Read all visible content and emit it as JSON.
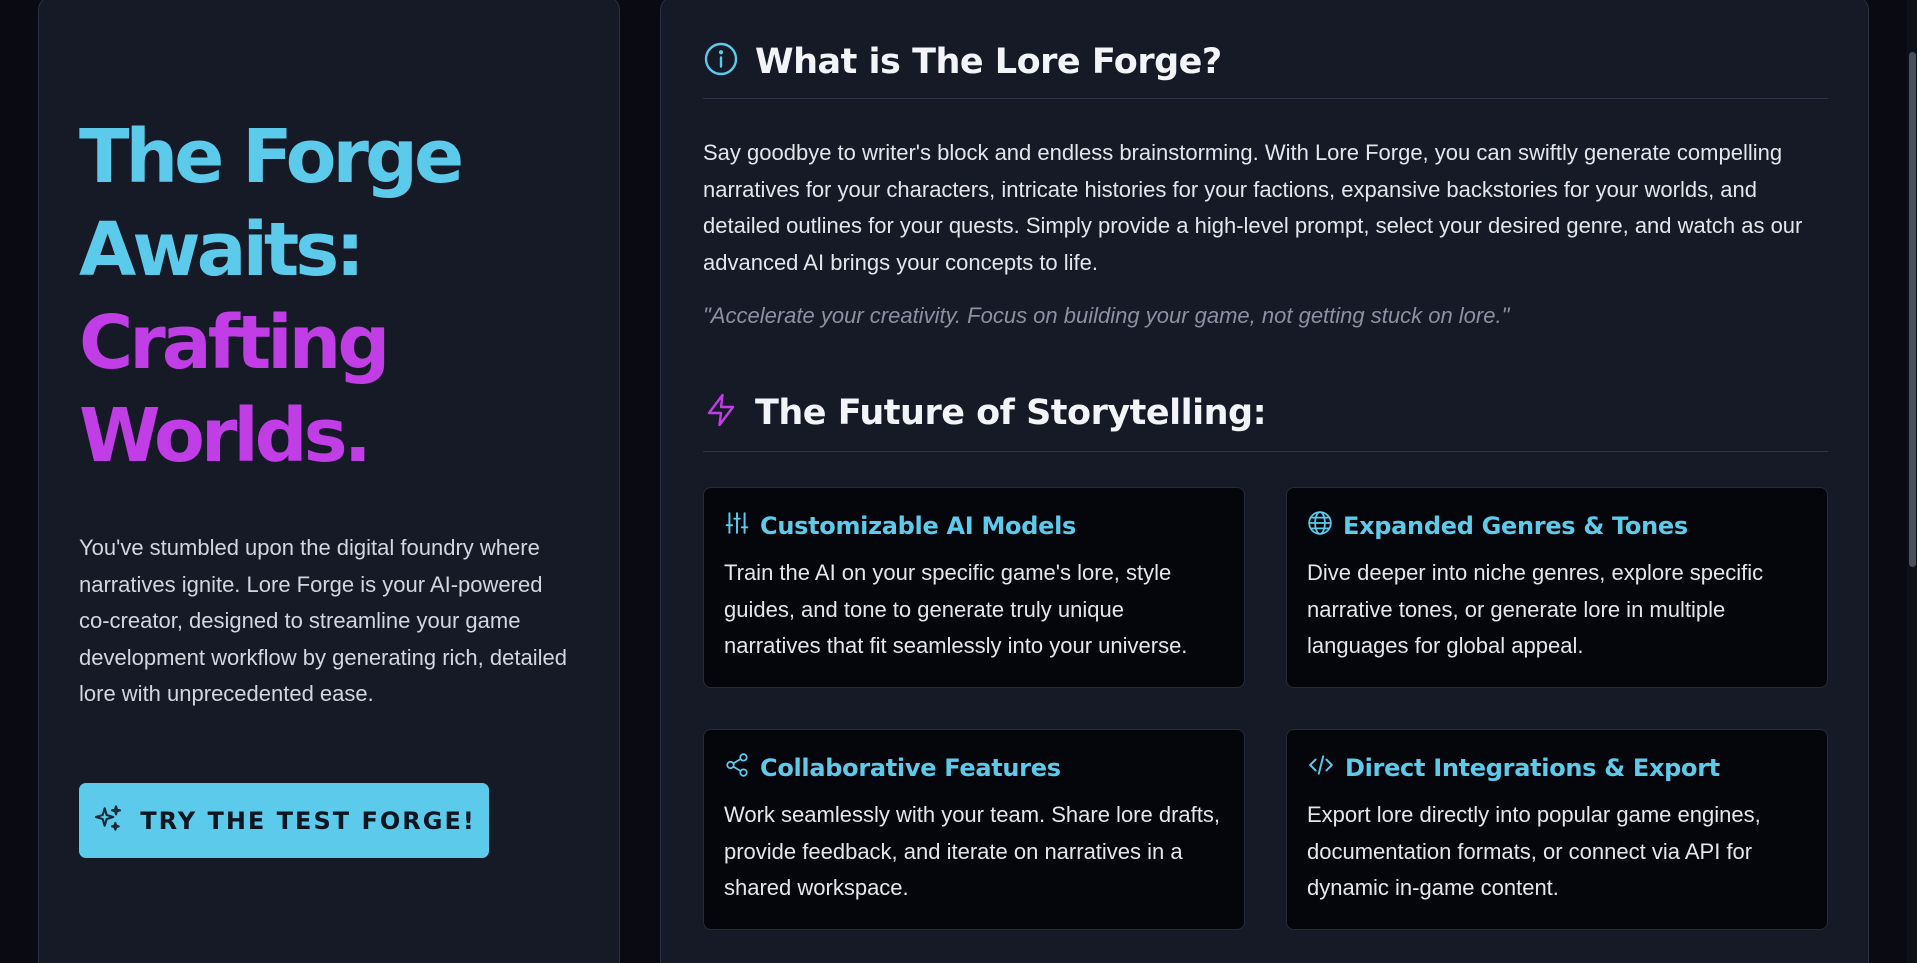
{
  "hero": {
    "title_line1": "The Forge",
    "title_line2": "Awaits:",
    "title_line3": "Crafting",
    "title_line4": "Worlds.",
    "description": "You've stumbled upon the digital foundry where narratives ignite. Lore Forge is your AI-powered co-creator, designed to streamline your game development workflow by generating rich, detailed lore with unprecedented ease.",
    "cta_label": "TRY THE TEST FORGE!",
    "cta_icon": "sparkles-icon"
  },
  "about": {
    "heading": "What is The Lore Forge?",
    "icon": "info-icon",
    "text": "Say goodbye to writer's block and endless brainstorming. With Lore Forge, you can swiftly generate compelling narratives for your characters, intricate histories for your factions, expansive backstories for your worlds, and detailed outlines for your quests. Simply provide a high-level prompt, select your desired genre, and watch as our advanced AI brings your concepts to life.",
    "quote": "\"Accelerate your creativity. Focus on building your game, not getting stuck on lore.\""
  },
  "future": {
    "heading": "The Future of Storytelling:",
    "icon": "lightning-icon",
    "features": [
      {
        "title": "Customizable AI Models",
        "icon": "sliders-icon",
        "text": "Train the AI on your specific game's lore, style guides, and tone to generate truly unique narratives that fit seamlessly into your universe."
      },
      {
        "title": "Expanded Genres & Tones",
        "icon": "globe-icon",
        "text": "Dive deeper into niche genres, explore specific narrative tones, or generate lore in multiple languages for global appeal."
      },
      {
        "title": "Collaborative Features",
        "icon": "share-icon",
        "text": "Work seamlessly with your team. Share lore drafts, provide feedback, and iterate on narratives in a shared workspace."
      },
      {
        "title": "Direct Integrations & Export",
        "icon": "code-icon",
        "text": "Export lore directly into popular game engines, documentation formats, or connect via API for dynamic in-game content."
      }
    ]
  },
  "colors": {
    "accent_cyan": "#5ccbeb",
    "accent_purple": "#c13ee6",
    "panel_bg": "#161a26",
    "card_bg": "#05060b",
    "page_bg": "#0a0b12"
  }
}
